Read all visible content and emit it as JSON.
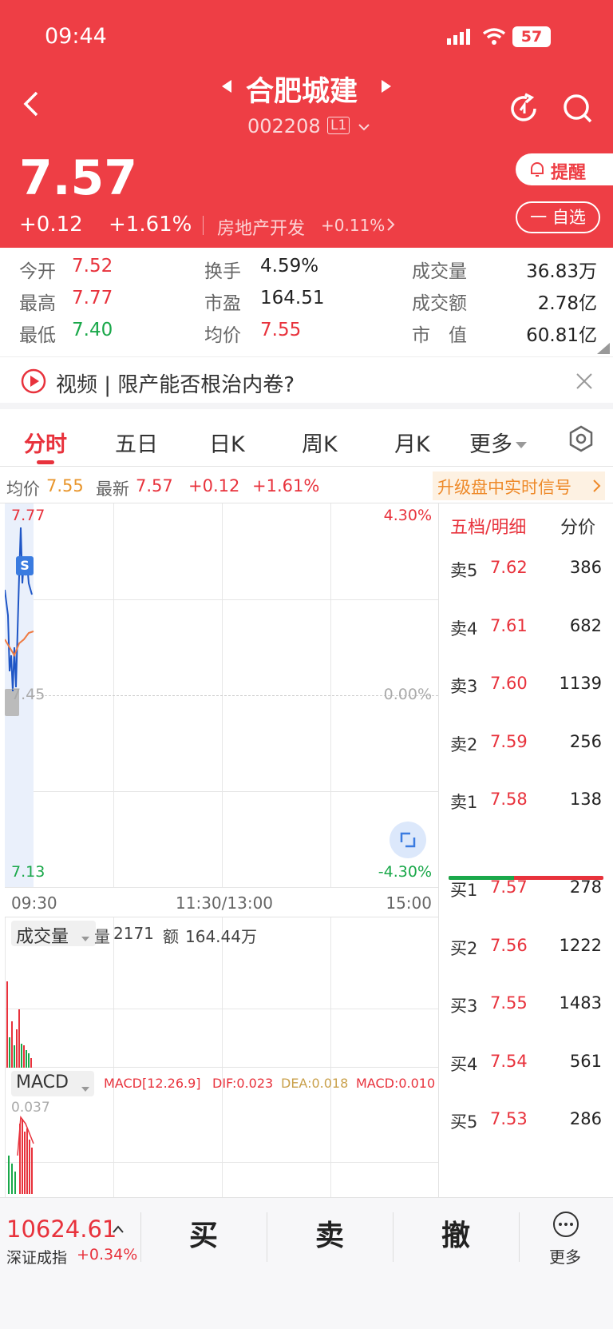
{
  "status": {
    "time": "09:44",
    "battery": "57"
  },
  "stock": {
    "name": "合肥城建",
    "code": "002208",
    "level": "L1",
    "price": "7.57",
    "change": "+0.12",
    "pct": "+1.61%",
    "sector": "房地产开发",
    "sector_pct": "+0.11%",
    "remind": "提醒",
    "watch": "一 自选"
  },
  "stats": [
    {
      "l": "今开",
      "v": "7.52"
    },
    {
      "l": "换手",
      "v": "4.59%"
    },
    {
      "l": "成交量",
      "v": "36.83万"
    },
    {
      "l": "最高",
      "v": "7.77"
    },
    {
      "l": "市盈",
      "v": "164.51"
    },
    {
      "l": "成交额",
      "v": "2.78亿"
    },
    {
      "l": "最低",
      "v": "7.40"
    },
    {
      "l": "均价",
      "v": "7.55"
    },
    {
      "l": "市　值",
      "v": "60.81亿"
    }
  ],
  "video": {
    "text": "视频 | 限产能否根治内卷?"
  },
  "tabs": [
    "分时",
    "五日",
    "日K",
    "周K",
    "月K",
    "更多"
  ],
  "info": {
    "avg_label": "均价",
    "avg": "7.55",
    "latest_label": "最新",
    "latest": "7.57",
    "chg": "+0.12",
    "pct": "+1.61%",
    "upgrade": "升级盘中实时信号"
  },
  "chart": {
    "y_top": "7.77",
    "y_mid": "7.45",
    "y_bot": "7.13",
    "p_top": "4.30%",
    "p_mid": "0.00%",
    "p_bot": "-4.30%",
    "x0": "09:30",
    "x1": "11:30/13:00",
    "x2": "15:00",
    "s_badge": "S"
  },
  "volume": {
    "label": "成交量",
    "q_label": "量",
    "q": "2171",
    "amt_label": "额",
    "amt": "164.44万"
  },
  "macd": {
    "label": "MACD",
    "params": "MACD[12.26.9]",
    "dif": "DIF:0.023",
    "dea": "DEA:0.018",
    "macd": "MACD:0.010",
    "top": "0.037"
  },
  "book": {
    "tab1": "五档/明细",
    "tab2": "分价",
    "asks": [
      {
        "l": "卖5",
        "p": "7.62",
        "v": "386"
      },
      {
        "l": "卖4",
        "p": "7.61",
        "v": "682"
      },
      {
        "l": "卖3",
        "p": "7.60",
        "v": "1139"
      },
      {
        "l": "卖2",
        "p": "7.59",
        "v": "256"
      },
      {
        "l": "卖1",
        "p": "7.58",
        "v": "138"
      }
    ],
    "bids": [
      {
        "l": "买1",
        "p": "7.57",
        "v": "278"
      },
      {
        "l": "买2",
        "p": "7.56",
        "v": "1222"
      },
      {
        "l": "买3",
        "p": "7.55",
        "v": "1483"
      },
      {
        "l": "买4",
        "p": "7.54",
        "v": "561"
      },
      {
        "l": "买5",
        "p": "7.53",
        "v": "286"
      }
    ]
  },
  "bottom": {
    "index": "10624.61",
    "index_name": "深证成指",
    "index_pct": "+0.34%",
    "buy": "买",
    "sell": "卖",
    "cancel": "撤",
    "more": "更多"
  }
}
